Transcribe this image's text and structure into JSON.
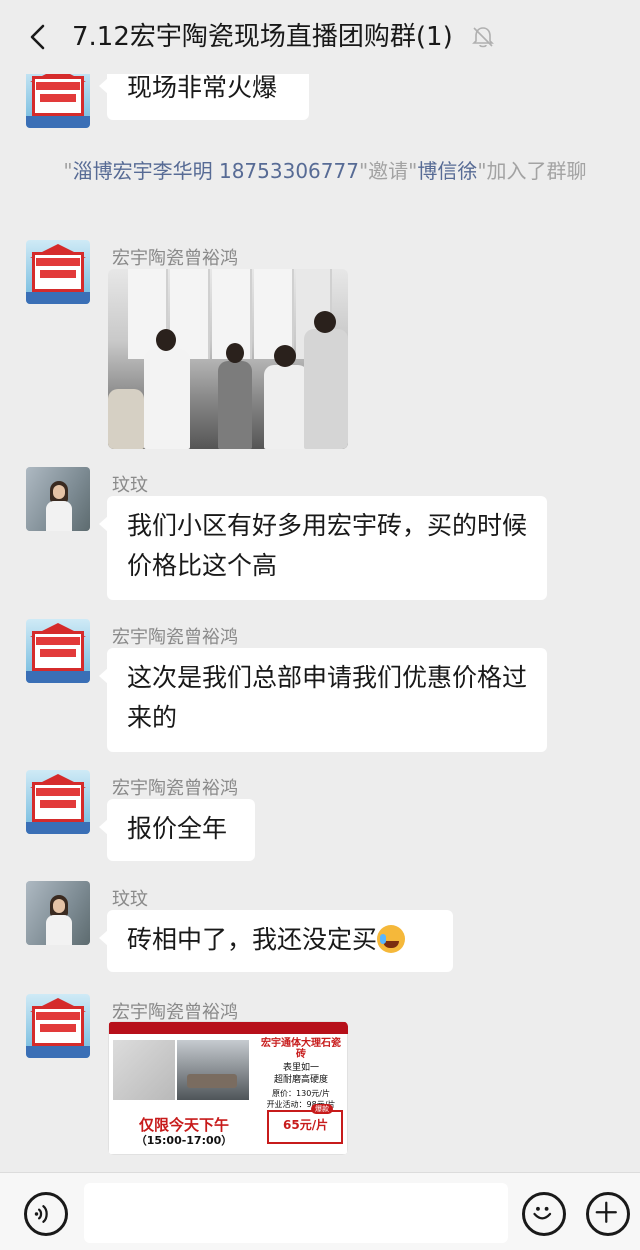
{
  "header": {
    "title": "7.12宏宇陶瓷现场直播团购群(1)",
    "back_icon": "chevron-left-icon",
    "mute_icon": "bell-off-icon"
  },
  "messages": [
    {
      "type": "text",
      "text": "现场非常火爆",
      "avatar": "ceramic-promo-avatar"
    },
    {
      "type": "system",
      "inviter": "淄博宏宇李华明 18753306777",
      "invitee": "博信徐",
      "text_pre": "\"",
      "text_mid1": "\"邀请\"",
      "text_post": "\"加入了群聊"
    },
    {
      "type": "image",
      "sender": "宏宇陶瓷曾裕鸿",
      "avatar": "ceramic-promo-avatar",
      "image": "showroom-crowd-photo"
    },
    {
      "type": "text",
      "sender": "玟玟",
      "avatar": "person-avatar",
      "text": "我们小区有好多用宏宇砖，买的时候价格比这个高"
    },
    {
      "type": "text",
      "sender": "宏宇陶瓷曾裕鸿",
      "avatar": "ceramic-promo-avatar",
      "text": "这次是我们总部申请我们优惠价格过来的"
    },
    {
      "type": "text",
      "sender": "宏宇陶瓷曾裕鸿",
      "avatar": "ceramic-promo-avatar",
      "text": "报价全年"
    },
    {
      "type": "text",
      "sender": "玟玟",
      "avatar": "person-avatar",
      "text": "砖相中了，我还没定买"
    },
    {
      "type": "image",
      "sender": "宏宇陶瓷曾裕鸿",
      "avatar": "ceramic-promo-avatar",
      "image": "tile-promo-poster"
    }
  ],
  "poster": {
    "headline": "宏宇通体大理石瓷砖",
    "line2": "表里如一",
    "line3": "超耐磨高硬度",
    "orig_price": "原价：130元/片",
    "event_price": "开业活动：98元/片",
    "badge": "爆款",
    "final_price": "65元/片",
    "limit": "仅限今天下午",
    "time": "（15:00-17:00）"
  },
  "footer": {
    "voice_icon": "voice-icon",
    "emoji_icon": "emoji-icon",
    "plus_icon": "plus-icon",
    "input_placeholder": ""
  }
}
